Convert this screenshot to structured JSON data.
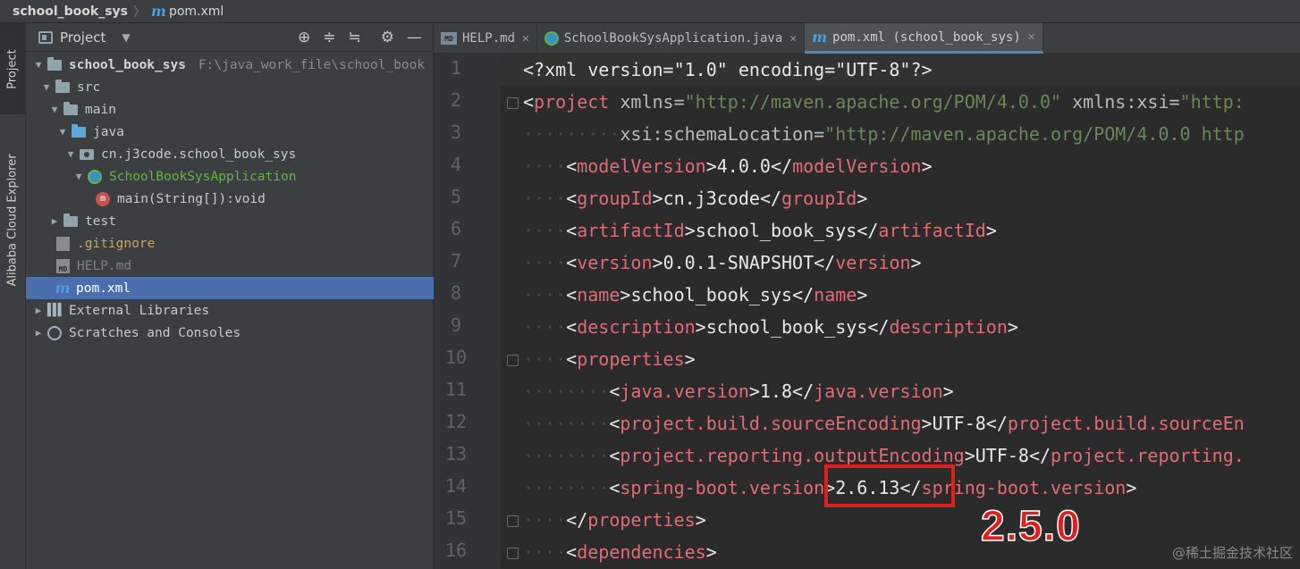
{
  "breadcrumb": {
    "project": "school_book_sys",
    "file": "pom.xml"
  },
  "tool_strip": {
    "project_tab": "Project",
    "cloud_tab": "Alibaba Cloud Explorer"
  },
  "project_panel": {
    "title": "Project",
    "tree": [
      {
        "label": "school_book_sys",
        "path": "F:\\java_work_file\\school_book"
      },
      {
        "label": "src"
      },
      {
        "label": "main"
      },
      {
        "label": "java"
      },
      {
        "label": "cn.j3code.school_book_sys"
      },
      {
        "label": "SchoolBookSysApplication"
      },
      {
        "label": "main(String[]):void"
      },
      {
        "label": "test"
      },
      {
        "label": ".gitignore"
      },
      {
        "label": "HELP.md"
      },
      {
        "label": "pom.xml"
      },
      {
        "label": "External Libraries"
      },
      {
        "label": "Scratches and Consoles"
      }
    ]
  },
  "editor_tabs": [
    {
      "label": "HELP.md",
      "icon": "markdown-icon"
    },
    {
      "label": "SchoolBookSysApplication.java",
      "icon": "spring-app-icon"
    },
    {
      "label": "pom.xml (school_book_sys)",
      "icon": "maven-icon",
      "active": true
    }
  ],
  "editor": {
    "line_numbers": [
      "1",
      "2",
      "3",
      "4",
      "5",
      "6",
      "7",
      "8",
      "9",
      "10",
      "11",
      "12",
      "13",
      "14",
      "15",
      "16"
    ],
    "lines": {
      "l1_decl": "<?xml version=\"1.0\" encoding=\"UTF-8\"?>",
      "l2_tag": "project",
      "l2_attr1": "xmlns=",
      "l2_val1": "\"http://maven.apache.org/POM/4.0.0\"",
      "l2_attr2": "xmlns:xsi=",
      "l2_val2": "\"http:",
      "l3_attr": "xsi:schemaLocation=",
      "l3_val": "\"http://maven.apache.org/POM/4.0.0 http",
      "l4_tag": "modelVersion",
      "l4_val": "4.0.0",
      "l5_tag": "groupId",
      "l5_val": "cn.j3code",
      "l6_tag": "artifactId",
      "l6_val": "school_book_sys",
      "l7_tag": "version",
      "l7_val": "0.0.1-SNAPSHOT",
      "l8_tag": "name",
      "l8_val": "school_book_sys",
      "l9_tag": "description",
      "l9_val": "school_book_sys",
      "l10_tag": "properties",
      "l11_tag": "java.version",
      "l11_val": "1.8",
      "l12_tag": "project.build.sourceEncoding",
      "l12_val": "UTF-8",
      "l12_close": "project.build.sourceEn",
      "l13_tag": "project.reporting.outputEncoding",
      "l13_val": "UTF-8",
      "l13_close": "project.reporting.",
      "l14_tag": "spring-boot.version",
      "l14_val": "2.6.13",
      "l15_tag": "properties",
      "l16_tag": "dependencies"
    }
  },
  "annotation": {
    "target_version": "2.5.0",
    "color": "#e02020"
  },
  "watermark": "@稀土掘金技术社区",
  "colors": {
    "tag": "#e8bf6a",
    "value_string": "#6a8759",
    "selection": "#4b6eaf",
    "active_tab_underline": "#4a88c7"
  }
}
